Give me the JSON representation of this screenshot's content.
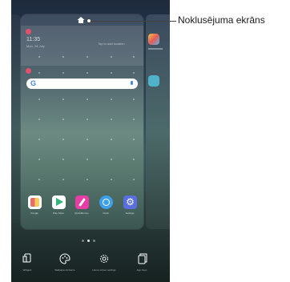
{
  "home_screen_label": "Noklusējuma ekrāns",
  "preview": {
    "clock_time": "11:35",
    "clock_sub": "Mon, 28 July",
    "weather_text": "Tap to add location",
    "search_logo": "G",
    "home_icon": "home-icon"
  },
  "dock_apps": [
    {
      "label": "Google",
      "icon": "google-folder-icon"
    },
    {
      "label": "Play Store",
      "icon": "play-store-icon"
    },
    {
      "label": "QuickMemo+",
      "icon": "quickmemo-icon"
    },
    {
      "label": "Clock",
      "icon": "clock-icon"
    },
    {
      "label": "Settings",
      "icon": "settings-icon"
    }
  ],
  "bottom_options": [
    {
      "label": "Widgets",
      "icon": "widgets-icon"
    },
    {
      "label": "Wallpaper & theme",
      "icon": "palette-icon"
    },
    {
      "label": "Home screen settings",
      "icon": "gear-icon"
    },
    {
      "label": "App trays",
      "icon": "app-tray-icon"
    }
  ]
}
